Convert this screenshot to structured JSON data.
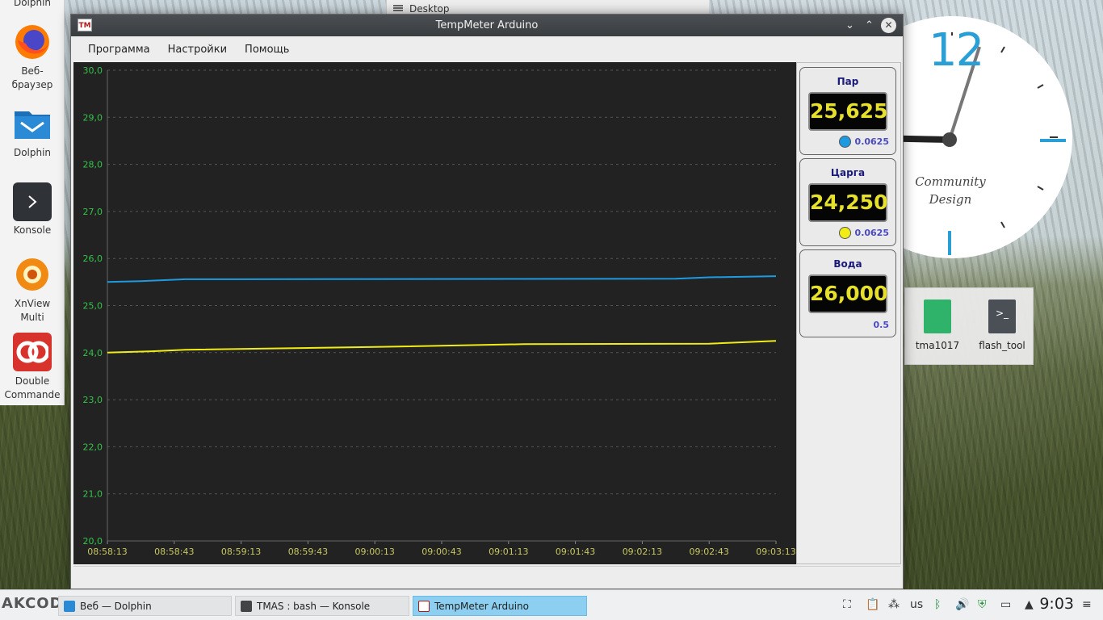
{
  "desktop": {
    "label": "Desktop",
    "clock_number": "12",
    "clock_brand_line1": "Community",
    "clock_brand_line2": "Design",
    "folder_items": [
      {
        "label": "tma1017"
      },
      {
        "label": "flash_tool"
      }
    ]
  },
  "dock": {
    "items": [
      {
        "label": "Dolphin"
      },
      {
        "label": "Веб-\nбраузер"
      },
      {
        "label": "Dolphin"
      },
      {
        "label": "Konsole"
      },
      {
        "label": "XnView\nMulti"
      },
      {
        "label": "Double\nCommande"
      }
    ]
  },
  "window": {
    "title": "TempMeter Arduino",
    "menu": [
      "Программа",
      "Настройки",
      "Помощь"
    ],
    "sensors": [
      {
        "name": "Пар",
        "value": "25,625",
        "resolution": "0.0625",
        "color": "#1e9be0"
      },
      {
        "name": "Царга",
        "value": "24,250",
        "resolution": "0.0625",
        "color": "#f0ec16"
      },
      {
        "name": "Вода",
        "value": "26,000",
        "resolution": "0.5",
        "color": null
      }
    ]
  },
  "chart_data": {
    "type": "line",
    "y_ticks": [
      "30,0",
      "29,0",
      "28,0",
      "27,0",
      "26,0",
      "25,0",
      "24,0",
      "23,0",
      "22,0",
      "21,0",
      "20,0"
    ],
    "ylim": [
      20,
      30
    ],
    "x_ticks": [
      "08:58:13",
      "08:58:43",
      "08:59:13",
      "08:59:43",
      "09:00:13",
      "09:00:43",
      "09:01:13",
      "09:01:43",
      "09:02:13",
      "09:02:43",
      "09:03:13"
    ],
    "grid": true,
    "series": [
      {
        "color": "#1e9be0",
        "x": [
          "08:58:13",
          "08:58:28",
          "08:58:48",
          "08:59:13",
          "09:02:28",
          "09:02:43",
          "09:03:13"
        ],
        "values": [
          25.5,
          25.52,
          25.56,
          25.56,
          25.57,
          25.6,
          25.625
        ]
      },
      {
        "color": "#f0ec16",
        "x": [
          "08:58:13",
          "08:58:33",
          "08:58:48",
          "09:00:13",
          "09:01:20",
          "09:02:43",
          "09:03:13"
        ],
        "values": [
          24.0,
          24.03,
          24.06,
          24.12,
          24.18,
          24.19,
          24.25
        ]
      }
    ]
  },
  "taskbar": {
    "tasks": [
      {
        "label": "Веб — Dolphin"
      },
      {
        "label": "TMAS : bash — Konsole"
      },
      {
        "label": "TempMeter Arduino"
      }
    ],
    "keyboard_layout": "us",
    "time": "9:03",
    "watermark": "AKCODISTILLERS.RU"
  }
}
